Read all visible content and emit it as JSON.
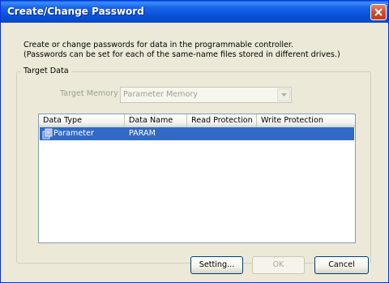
{
  "window": {
    "title": "Create/Change Password"
  },
  "description": {
    "line1": "Create or change passwords for data in the programmable controller.",
    "line2": "(Passwords can be set for each of the same-name files stored in different drives.)"
  },
  "target_data": {
    "legend": "Target Data",
    "target_memory_label": "Target Memory",
    "target_memory_value": "Parameter Memory",
    "columns": [
      "Data Type",
      "Data Name",
      "Read Protection",
      "Write Protection"
    ],
    "rows": [
      {
        "data_type": "Parameter",
        "data_name": "PARAM",
        "read_protection": "",
        "write_protection": "",
        "selected": true
      }
    ]
  },
  "buttons": {
    "setting": "Setting...",
    "ok": "OK",
    "cancel": "Cancel"
  },
  "colors": {
    "selection": "#316ac5",
    "titlebar": "#0551d6",
    "dialog_bg": "#ece9d8"
  }
}
